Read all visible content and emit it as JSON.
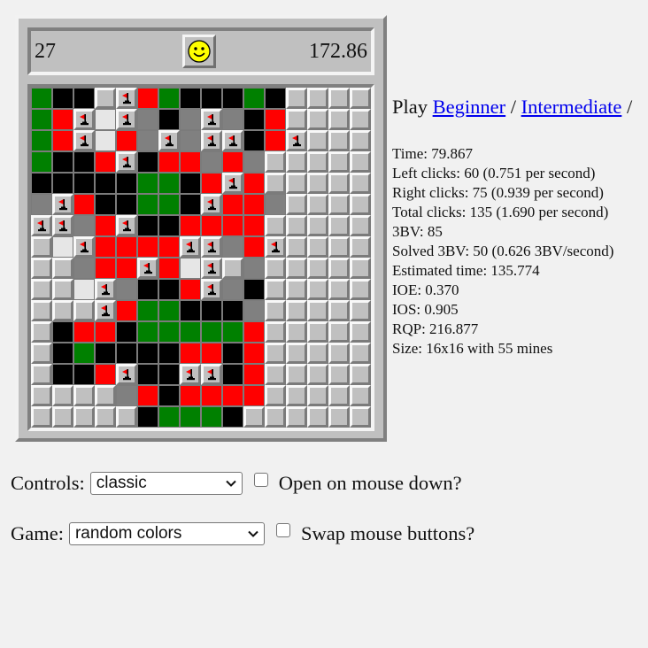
{
  "header": {
    "mines_left": "27",
    "time": "172.86",
    "face_icon": "smiley-face-icon"
  },
  "links": {
    "play_prefix": "Play ",
    "beginner": "Beginner",
    "sep1": " / ",
    "intermediate": "Intermediate",
    "sep2": " /"
  },
  "stats": [
    "Time: 79.867",
    "Left clicks: 60 (0.751 per second)",
    "Right clicks: 75 (0.939 per second)",
    "Total clicks: 135 (1.690 per second)",
    "3BV: 85",
    "Solved 3BV: 50 (0.626 3BV/second)",
    "Estimated time: 135.774",
    "IOE: 0.370",
    "IOS: 0.905",
    "RQP: 216.877",
    "Size: 16x16 with 55 mines"
  ],
  "controls": {
    "label": "Controls:",
    "value": "classic",
    "open_on_mouse_down_label": "Open on mouse down?",
    "open_on_mouse_down_checked": false
  },
  "game": {
    "label": "Game:",
    "value": "random colors",
    "swap_mouse_buttons_label": "Swap mouse buttons?",
    "swap_mouse_buttons_checked": false
  },
  "board": {
    "size": 16,
    "legend": {
      "G": "open-green",
      "K": "open-black",
      "R": "open-red",
      "W": "open-white",
      "D": "open-gray",
      "C": "covered",
      "F": "flag"
    },
    "colors": {
      "G": "#008000",
      "K": "#000000",
      "R": "#ff0000",
      "W": "#e6e6e6",
      "D": "#808080",
      "C": "#c0c0c0"
    },
    "rows": [
      "GKKCFRGKKKGKCCCC",
      "GRFWFDKDFDKRCCCC",
      "GRFWRDFDFFKRFCCC",
      "GKKRFKRRDRDCCCCC",
      "KKKKKGGKRFRCCCCC",
      "DFRKKGGKFRRDCCCC",
      "FFDRFKKRRRRCCCCC",
      "CWFRRRRFFDRFCCCC",
      "CCDRRFRWFCDCCCCC",
      "CCWFDKKRFDKCCCCC",
      "CCCFRGGKKKDCCCCC",
      "CKRRKGGGGGRCCCCC",
      "CKGKKKKRRKRCCCCC",
      "CKKRFKKFFKRCCCCC",
      "CCCCDRKRRRRCCCCC",
      "CCCCCKGGGKCCCCCC"
    ]
  }
}
